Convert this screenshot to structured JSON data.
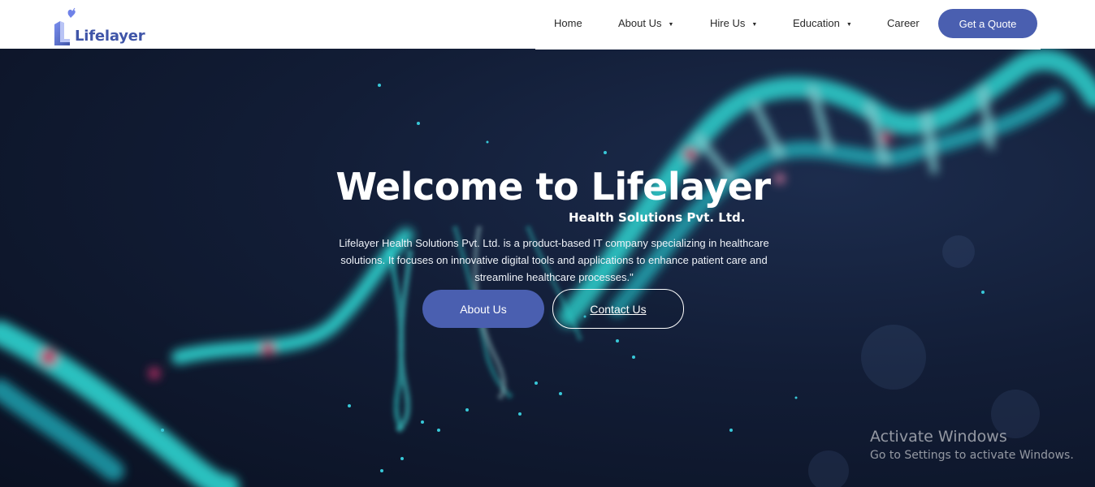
{
  "header": {
    "logo_text": "Lifelayer",
    "nav": [
      {
        "label": "Home",
        "dropdown": false
      },
      {
        "label": "About Us",
        "dropdown": true
      },
      {
        "label": "Hire Us",
        "dropdown": true
      },
      {
        "label": "Education",
        "dropdown": true
      },
      {
        "label": "Career",
        "dropdown": false
      }
    ],
    "quote_button": "Get a Quote"
  },
  "hero": {
    "title": "Welcome to Lifelayer",
    "subtitle": "Health Solutions Pvt. Ltd.",
    "description": "Lifelayer Health Solutions Pvt. Ltd. is a product-based IT company specializing in healthcare solutions. It focuses on innovative digital tools and applications to enhance patient care and streamline healthcare processes.\"",
    "about_button": "About Us",
    "contact_button": "Contact Us"
  },
  "watermark": {
    "title": "Activate Windows",
    "subtitle": "Go to Settings to activate Windows."
  },
  "colors": {
    "brand": "#4a5fb0",
    "header_bg": "#ffffff",
    "dna_cyan": "#2fd4d0",
    "dna_pink": "#d0306e"
  },
  "icons": {
    "logo": "lifelayer-logo-mark",
    "caret": "caret-down-icon"
  }
}
